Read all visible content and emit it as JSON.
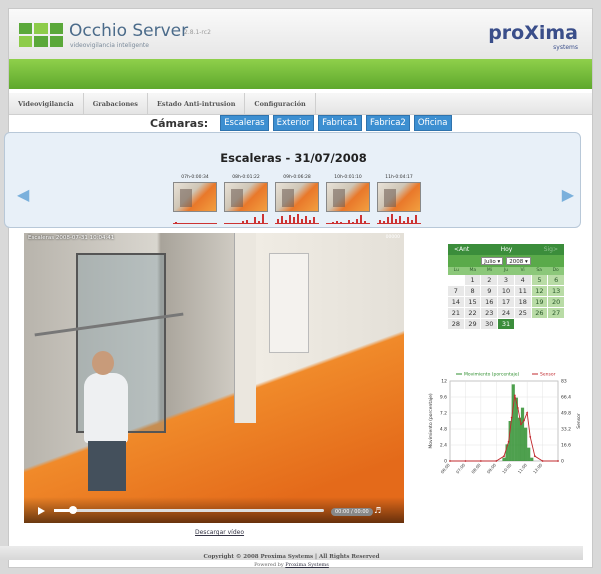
{
  "header": {
    "app_name": "Occhio Server",
    "version": "2.8.1-rc2",
    "tagline": "videovigilancia inteligente",
    "brand": "proXima",
    "brand_sub": "systems"
  },
  "nav": [
    "Videovigilancia",
    "Grabaciones",
    "Estado Anti-intrusion",
    "Configuración"
  ],
  "cameras": {
    "label": "Cámaras:",
    "items": [
      "Escaleras",
      "Exterior",
      "Fabrica1",
      "Fabrica2",
      "Oficina"
    ]
  },
  "strip": {
    "title": "Escaleras - 31/07/2008",
    "thumbs": [
      {
        "time": "07h-0:00:34",
        "activity": [
          0.1,
          0.0,
          0.0,
          0.0,
          0.0,
          0.0,
          0.0,
          0.0,
          0.0,
          0.0
        ]
      },
      {
        "time": "08h-0:01:22",
        "activity": [
          0.0,
          0.0,
          0.0,
          0.0,
          0.2,
          0.3,
          0.0,
          0.5,
          0.2,
          0.8
        ]
      },
      {
        "time": "09h-0:06:28",
        "activity": [
          0.4,
          0.6,
          0.3,
          0.7,
          0.5,
          0.8,
          0.4,
          0.6,
          0.3,
          0.5
        ]
      },
      {
        "time": "10h-0:01:10",
        "activity": [
          0.0,
          0.1,
          0.2,
          0.1,
          0.0,
          0.3,
          0.1,
          0.4,
          0.7,
          0.2
        ]
      },
      {
        "time": "11h-0:04:17",
        "activity": [
          0.3,
          0.2,
          0.5,
          0.8,
          0.4,
          0.6,
          0.2,
          0.5,
          0.3,
          0.7
        ]
      }
    ]
  },
  "video": {
    "caption": "Escaleras 2008-07-31 10:04:41",
    "corner": "00000",
    "progress": 0.07,
    "time_readout": "00:00 / 00:00",
    "download_label": "Descargar vídeo"
  },
  "calendar": {
    "prev": "<Ant",
    "today": "Hoy",
    "next": "Sig>",
    "month": "Julio",
    "year": "2008",
    "weekdays": [
      "Lu",
      "Ma",
      "Mi",
      "Ju",
      "Vi",
      "Sa",
      "Do"
    ],
    "leading_blanks": 1,
    "days": 31,
    "selected_day": 31
  },
  "chart_data": {
    "type": "line",
    "title": "",
    "series": [
      {
        "name": "Movimiento (porcentaje)",
        "axis": "left",
        "style": "bar",
        "color": "#2f8f2f"
      },
      {
        "name": "Sensor",
        "axis": "right",
        "style": "line",
        "color": "#c0282d"
      }
    ],
    "x": [
      "06:00",
      "07:00",
      "08:00",
      "09:00",
      "10:00",
      "11:00",
      "12:00"
    ],
    "bar_x": [
      9.5,
      9.7,
      9.9,
      10.1,
      10.3,
      10.5,
      10.7,
      10.9,
      11.1,
      11.3,
      11.5
    ],
    "bar_values": [
      0.5,
      2.5,
      6.0,
      11.5,
      9.5,
      6.5,
      8.0,
      5.0,
      2.0,
      0.5,
      0.0
    ],
    "line_x": [
      6,
      7,
      8,
      9,
      9.5,
      9.8,
      10.0,
      10.2,
      10.4,
      10.6,
      10.8,
      11.0,
      11.2,
      11.5,
      12,
      13
    ],
    "line_values": [
      0,
      0,
      0,
      0,
      5,
      20,
      45,
      68,
      55,
      38,
      42,
      50,
      25,
      5,
      0,
      0
    ],
    "ylabel_left": "Movimiento (porcentaje)",
    "ylabel_right": "Sensor",
    "yticks_left": [
      "0",
      "2.4",
      "4.8",
      "7.2",
      "9.6",
      "12"
    ],
    "yticks_right": [
      "0",
      "16.6",
      "33.2",
      "49.8",
      "66.4",
      "83"
    ],
    "ylim_left": [
      0,
      12
    ],
    "ylim_right": [
      0,
      83
    ],
    "xlim": [
      6,
      13
    ],
    "legend": "top"
  },
  "footer": {
    "copyright": "Copyright © 2008 Proxima Systems | All Rights Reserved",
    "powered_prefix": "Powered by",
    "powered_link": "Proxima Systems"
  },
  "colors": {
    "accent_green": "#5ea82d",
    "camera_button": "#3d8fd1",
    "calendar_green": "#3b8d3b"
  }
}
